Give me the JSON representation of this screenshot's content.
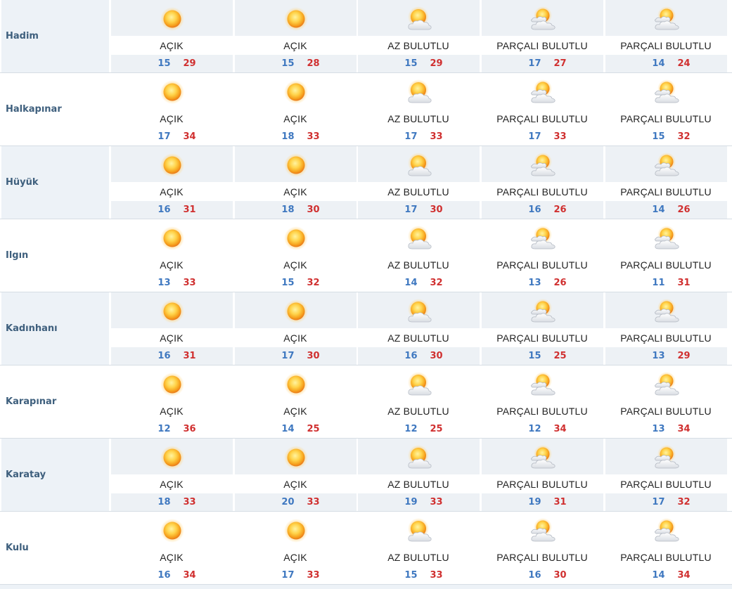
{
  "colors": {
    "row_tint": "#edf1f5",
    "city_text": "#3e5f7d",
    "min_temp": "#3f78c0",
    "max_temp": "#d03030"
  },
  "rows": [
    {
      "city": "Hadim",
      "days": [
        {
          "desc": "AÇIK",
          "icon": "sun-icon",
          "min": "15",
          "max": "29"
        },
        {
          "desc": "AÇIK",
          "icon": "sun-icon",
          "min": "15",
          "max": "28"
        },
        {
          "desc": "AZ BULUTLU",
          "icon": "sun-cloud-icon",
          "min": "15",
          "max": "29"
        },
        {
          "desc": "PARÇALI BULUTLU",
          "icon": "partly-cloudy-icon",
          "min": "17",
          "max": "27"
        },
        {
          "desc": "PARÇALI BULUTLU",
          "icon": "partly-cloudy-icon",
          "min": "14",
          "max": "24"
        }
      ]
    },
    {
      "city": "Halkapınar",
      "days": [
        {
          "desc": "AÇIK",
          "icon": "sun-icon",
          "min": "17",
          "max": "34"
        },
        {
          "desc": "AÇIK",
          "icon": "sun-icon",
          "min": "18",
          "max": "33"
        },
        {
          "desc": "AZ BULUTLU",
          "icon": "sun-cloud-icon",
          "min": "17",
          "max": "33"
        },
        {
          "desc": "PARÇALI BULUTLU",
          "icon": "partly-cloudy-icon",
          "min": "17",
          "max": "33"
        },
        {
          "desc": "PARÇALI BULUTLU",
          "icon": "partly-cloudy-icon",
          "min": "15",
          "max": "32"
        }
      ]
    },
    {
      "city": "Hüyük",
      "days": [
        {
          "desc": "AÇIK",
          "icon": "sun-icon",
          "min": "16",
          "max": "31"
        },
        {
          "desc": "AÇIK",
          "icon": "sun-icon",
          "min": "18",
          "max": "30"
        },
        {
          "desc": "AZ BULUTLU",
          "icon": "sun-cloud-icon",
          "min": "17",
          "max": "30"
        },
        {
          "desc": "PARÇALI BULUTLU",
          "icon": "partly-cloudy-icon",
          "min": "16",
          "max": "26"
        },
        {
          "desc": "PARÇALI BULUTLU",
          "icon": "partly-cloudy-icon",
          "min": "14",
          "max": "26"
        }
      ]
    },
    {
      "city": "Ilgın",
      "days": [
        {
          "desc": "AÇIK",
          "icon": "sun-icon",
          "min": "13",
          "max": "33"
        },
        {
          "desc": "AÇIK",
          "icon": "sun-icon",
          "min": "15",
          "max": "32"
        },
        {
          "desc": "AZ BULUTLU",
          "icon": "sun-cloud-icon",
          "min": "14",
          "max": "32"
        },
        {
          "desc": "PARÇALI BULUTLU",
          "icon": "partly-cloudy-icon",
          "min": "13",
          "max": "26"
        },
        {
          "desc": "PARÇALI BULUTLU",
          "icon": "partly-cloudy-icon",
          "min": "11",
          "max": "31"
        }
      ]
    },
    {
      "city": "Kadınhanı",
      "days": [
        {
          "desc": "AÇIK",
          "icon": "sun-icon",
          "min": "16",
          "max": "31"
        },
        {
          "desc": "AÇIK",
          "icon": "sun-icon",
          "min": "17",
          "max": "30"
        },
        {
          "desc": "AZ BULUTLU",
          "icon": "sun-cloud-icon",
          "min": "16",
          "max": "30"
        },
        {
          "desc": "PARÇALI BULUTLU",
          "icon": "partly-cloudy-icon",
          "min": "15",
          "max": "25"
        },
        {
          "desc": "PARÇALI BULUTLU",
          "icon": "partly-cloudy-icon",
          "min": "13",
          "max": "29"
        }
      ]
    },
    {
      "city": "Karapınar",
      "days": [
        {
          "desc": "AÇIK",
          "icon": "sun-icon",
          "min": "12",
          "max": "36"
        },
        {
          "desc": "AÇIK",
          "icon": "sun-icon",
          "min": "14",
          "max": "25"
        },
        {
          "desc": "AZ BULUTLU",
          "icon": "sun-cloud-icon",
          "min": "12",
          "max": "25"
        },
        {
          "desc": "PARÇALI BULUTLU",
          "icon": "partly-cloudy-icon",
          "min": "12",
          "max": "34"
        },
        {
          "desc": "PARÇALI BULUTLU",
          "icon": "partly-cloudy-icon",
          "min": "13",
          "max": "34"
        }
      ]
    },
    {
      "city": "Karatay",
      "days": [
        {
          "desc": "AÇIK",
          "icon": "sun-icon",
          "min": "18",
          "max": "33"
        },
        {
          "desc": "AÇIK",
          "icon": "sun-icon",
          "min": "20",
          "max": "33"
        },
        {
          "desc": "AZ BULUTLU",
          "icon": "sun-cloud-icon",
          "min": "19",
          "max": "33"
        },
        {
          "desc": "PARÇALI BULUTLU",
          "icon": "partly-cloudy-icon",
          "min": "19",
          "max": "31"
        },
        {
          "desc": "PARÇALI BULUTLU",
          "icon": "partly-cloudy-icon",
          "min": "17",
          "max": "32"
        }
      ]
    },
    {
      "city": "Kulu",
      "days": [
        {
          "desc": "AÇIK",
          "icon": "sun-icon",
          "min": "16",
          "max": "34"
        },
        {
          "desc": "AÇIK",
          "icon": "sun-icon",
          "min": "17",
          "max": "33"
        },
        {
          "desc": "AZ BULUTLU",
          "icon": "sun-cloud-icon",
          "min": "15",
          "max": "33"
        },
        {
          "desc": "PARÇALI BULUTLU",
          "icon": "partly-cloudy-icon",
          "min": "16",
          "max": "30"
        },
        {
          "desc": "PARÇALI BULUTLU",
          "icon": "partly-cloudy-icon",
          "min": "14",
          "max": "34"
        }
      ]
    }
  ]
}
